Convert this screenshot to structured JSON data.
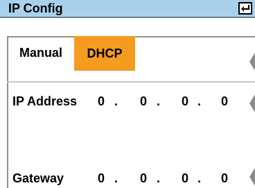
{
  "header": {
    "title": "IP Config",
    "enter_icon": "enter-icon"
  },
  "mode": {
    "manual_label": "Manual",
    "dhcp_label": "DHCP",
    "selected": "DHCP",
    "accent": "#f59b1f"
  },
  "ip_address": {
    "label": "IP Address",
    "octets": [
      "0",
      "0",
      "0",
      "0"
    ]
  },
  "gateway": {
    "label": "Gateway",
    "octets": [
      "0",
      "0",
      "0",
      "0"
    ]
  },
  "colors": {
    "titlebar": "#a9d1ec"
  }
}
